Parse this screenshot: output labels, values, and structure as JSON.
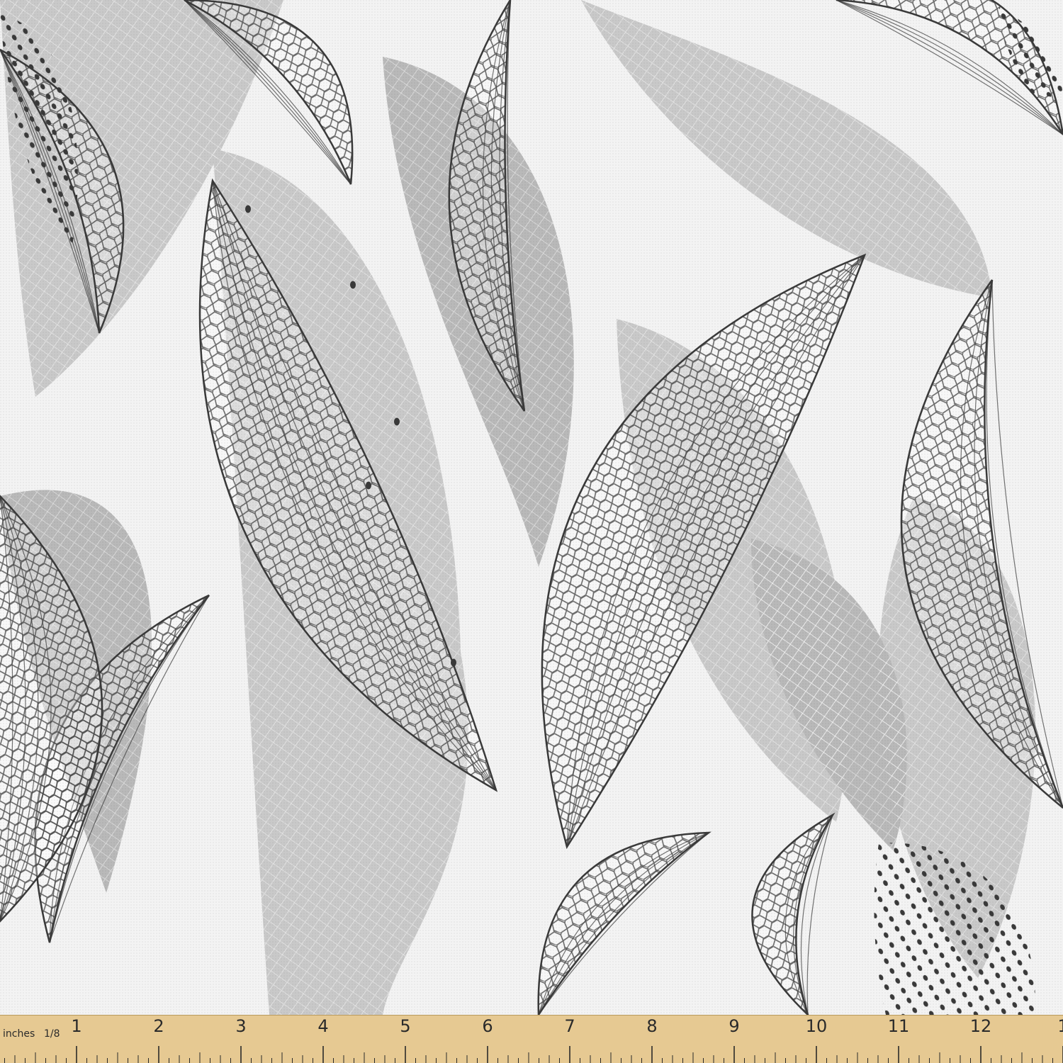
{
  "image": {
    "subject": "fabric swatch",
    "colors": {
      "background": "#f3f3f3",
      "shadow_leaf": "#c9c9c9",
      "shadow_leaf_dark": "#b9b9b9",
      "outline": "#3a3a3a",
      "dots": "#3a3a3a",
      "ruler_wood": "#e6c992",
      "ruler_ink": "#2a2a2a"
    }
  },
  "ruler": {
    "unit_label": "inches",
    "fraction_label": "1/8",
    "numbers": [
      "1",
      "2",
      "3",
      "4",
      "5",
      "6",
      "7",
      "8",
      "9",
      "10",
      "11",
      "12",
      "1"
    ]
  }
}
